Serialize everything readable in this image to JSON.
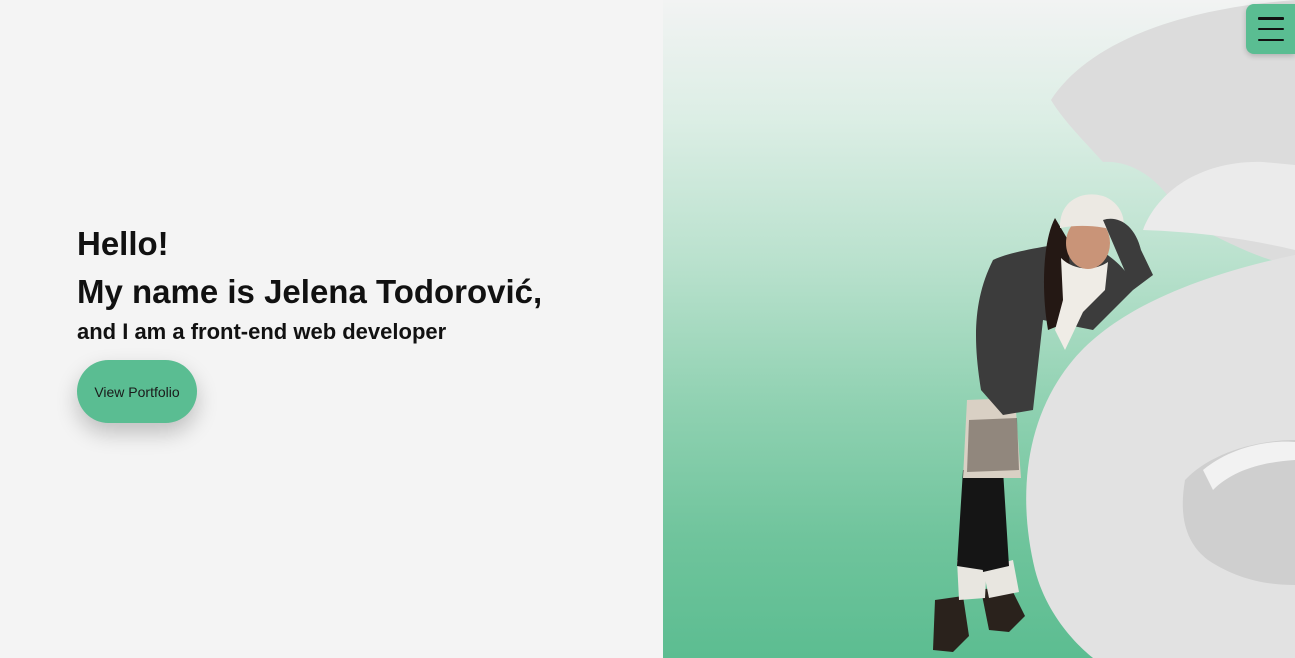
{
  "hero": {
    "greeting": "Hello!",
    "name_line": "My name is Jelena Todorović,",
    "role_line": "and I am a front-end web developer",
    "cta_label": "View Portfolio"
  },
  "nav": {
    "menu_icon": "hamburger-menu-icon"
  },
  "colors": {
    "accent": "#5abd92",
    "left_background": "#f4f4f4",
    "text": "#111111"
  }
}
